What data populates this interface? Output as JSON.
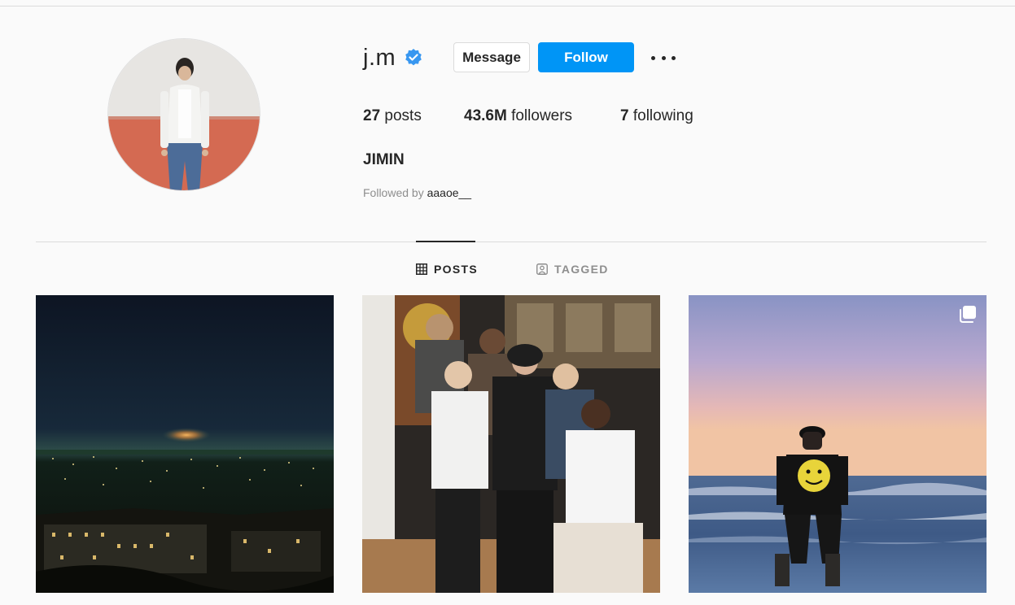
{
  "profile": {
    "username": "j.m",
    "verified": true,
    "display_name": "JIMIN",
    "followed_by_prefix": "Followed by ",
    "followed_by_user": "aaaoe__"
  },
  "actions": {
    "message_label": "Message",
    "follow_label": "Follow",
    "more_icon": "more-horizontal-icon"
  },
  "stats": {
    "posts_count": "27",
    "posts_label": " posts",
    "followers_count": "43.6M",
    "followers_label": " followers",
    "following_count": "7",
    "following_label": " following"
  },
  "tabs": [
    {
      "label": "POSTS",
      "icon": "grid-icon",
      "active": true
    },
    {
      "label": "TAGGED",
      "icon": "tagged-person-icon",
      "active": false
    }
  ],
  "posts": [
    {
      "subject": "night city skyline under moon",
      "multiple": false
    },
    {
      "subject": "group of six people posing in studio",
      "multiple": false
    },
    {
      "subject": "person in smiley shirt on beach at sunset",
      "multiple": true
    }
  ],
  "colors": {
    "follow_button": "#0095f6",
    "verified_badge": "#3897f0",
    "background": "#fafafa",
    "muted_text": "#8e8e8e"
  }
}
